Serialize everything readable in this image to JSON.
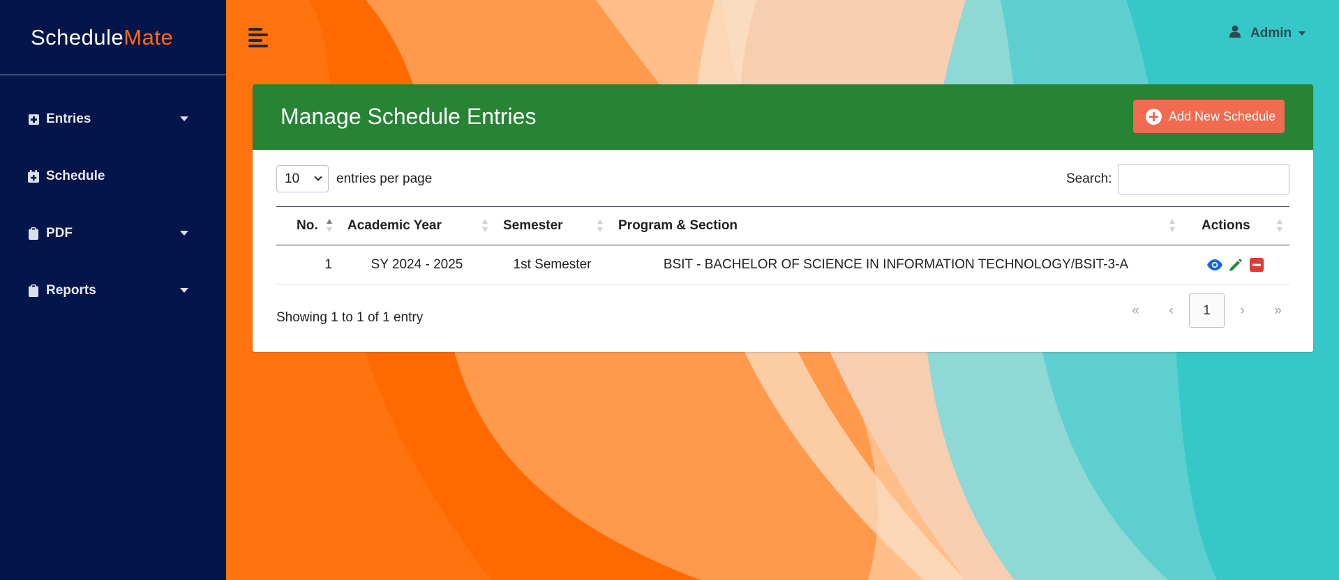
{
  "app": {
    "brand_part1": "Schedule",
    "brand_part2": "Mate"
  },
  "colors": {
    "sidebar": "#03154a",
    "brand_accent": "#ff6a13",
    "header_green": "#278434",
    "add_button": "#f26a50",
    "view_icon": "#1565e0",
    "edit_icon": "#1e8a3a",
    "delete_icon": "#e53935"
  },
  "sidebar": {
    "items": [
      {
        "label": "Entries",
        "icon": "plus-square-icon",
        "has_dropdown": true
      },
      {
        "label": "Schedule",
        "icon": "calendar-plus-icon",
        "has_dropdown": false
      },
      {
        "label": "PDF",
        "icon": "clipboard-icon",
        "has_dropdown": true
      },
      {
        "label": "Reports",
        "icon": "clipboard-icon",
        "has_dropdown": true
      }
    ]
  },
  "topbar": {
    "menu_icon": "menu-toggle-icon",
    "user_icon": "user-icon",
    "user_label": "Admin"
  },
  "card": {
    "title": "Manage Schedule Entries",
    "add_button_label": "Add New Schedule",
    "length_value": "10",
    "length_label": "entries per page",
    "search_label": "Search:",
    "search_value": "",
    "columns": [
      "No.",
      "Academic Year",
      "Semester",
      "Program & Section",
      "Actions"
    ],
    "rows": [
      {
        "no": "1",
        "academic_year": "SY 2024 - 2025",
        "semester": "1st Semester",
        "program_section": "BSIT - BACHELOR OF SCIENCE IN INFORMATION TECHNOLOGY/BSIT-3-A"
      }
    ],
    "info": "Showing 1 to 1 of 1 entry",
    "pagination": {
      "first": "«",
      "prev": "‹",
      "current": "1",
      "next": "›",
      "last": "»"
    }
  }
}
